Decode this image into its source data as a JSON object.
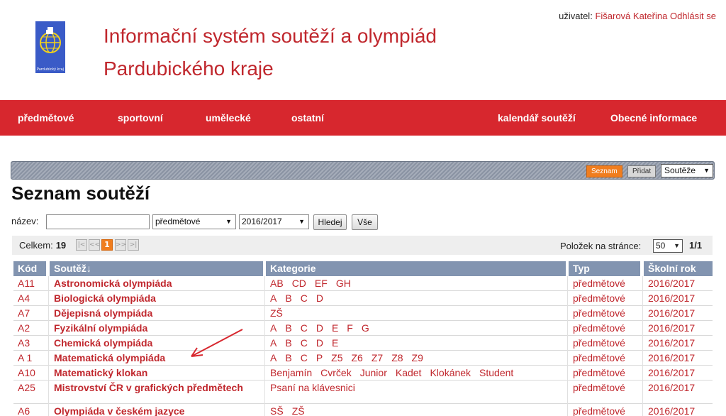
{
  "header": {
    "logo_text": "Pardubický kraj",
    "title_line1": "Informační systém soutěží a olympiád",
    "title_line2": "Pardubického kraje",
    "user_label": "uživatel:",
    "user_name": "Fišarová Kateřina",
    "logout": "Odhlásit se"
  },
  "nav": {
    "items": [
      "předmětové",
      "sportovní",
      "umělecké",
      "ostatní"
    ],
    "right_items": [
      "kalendář soutěží",
      "Obecné informace"
    ]
  },
  "toolbar": {
    "seznam": "Seznam",
    "pridat": "Přidat",
    "select_value": "Soutěže"
  },
  "page_title": "Seznam soutěží",
  "filter": {
    "label": "název:",
    "name_value": "",
    "type_value": "předmětové",
    "year_value": "2016/2017",
    "search_button": "Hledej",
    "all_button": "Vše"
  },
  "pager": {
    "total_label": "Celkem:",
    "total": "19",
    "first": "|<",
    "prev": "<<",
    "current": "1",
    "next": ">>",
    "last": ">|",
    "per_page_label": "Položek na stránce:",
    "per_page": "50",
    "pages": "1/1"
  },
  "table": {
    "headers": [
      "Kód",
      "Soutěž↓",
      "Kategorie",
      "Typ",
      "Školní rok"
    ],
    "rows": [
      {
        "code": "A11",
        "name": "Astronomická olympiáda",
        "categories": [
          "AB",
          "CD",
          "EF",
          "GH"
        ],
        "type": "předmětové",
        "year": "2016/2017"
      },
      {
        "code": "A4",
        "name": "Biologická olympiáda",
        "categories": [
          "A",
          "B",
          "C",
          "D"
        ],
        "type": "předmětové",
        "year": "2016/2017"
      },
      {
        "code": "A7",
        "name": "Dějepisná olympiáda",
        "categories": [
          "ZŠ"
        ],
        "type": "předmětové",
        "year": "2016/2017"
      },
      {
        "code": "A2",
        "name": "Fyzikální olympiáda",
        "categories": [
          "A",
          "B",
          "C",
          "D",
          "E",
          "F",
          "G"
        ],
        "type": "předmětové",
        "year": "2016/2017"
      },
      {
        "code": "A3",
        "name": "Chemická olympiáda",
        "categories": [
          "A",
          "B",
          "C",
          "D",
          "E"
        ],
        "type": "předmětové",
        "year": "2016/2017"
      },
      {
        "code": "A 1",
        "name": "Matematická olympiáda",
        "categories": [
          "A",
          "B",
          "C",
          "P",
          "Z5",
          "Z6",
          "Z7",
          "Z8",
          "Z9"
        ],
        "type": "předmětové",
        "year": "2016/2017"
      },
      {
        "code": "A10",
        "name": "Matematický klokan",
        "categories": [
          "Benjamín",
          "Cvrček",
          "Junior",
          "Kadet",
          "Klokánek",
          "Student"
        ],
        "type": "předmětové",
        "year": "2016/2017"
      },
      {
        "code": "A25",
        "name": "Mistrovství ČR v grafických předmětech",
        "categories": [
          "Psaní na klávesnici"
        ],
        "type": "předmětové",
        "year": "2016/2017"
      },
      {
        "code": "A6",
        "name": "Olympiáda v českém jazyce",
        "categories": [
          "SŠ",
          "ZŠ"
        ],
        "type": "předmětové",
        "year": "2016/2017"
      }
    ]
  },
  "colors": {
    "brand_red": "#d7272e",
    "link_red": "#c0272d",
    "header_blue": "#8294b0",
    "active_orange": "#f07d1e"
  }
}
